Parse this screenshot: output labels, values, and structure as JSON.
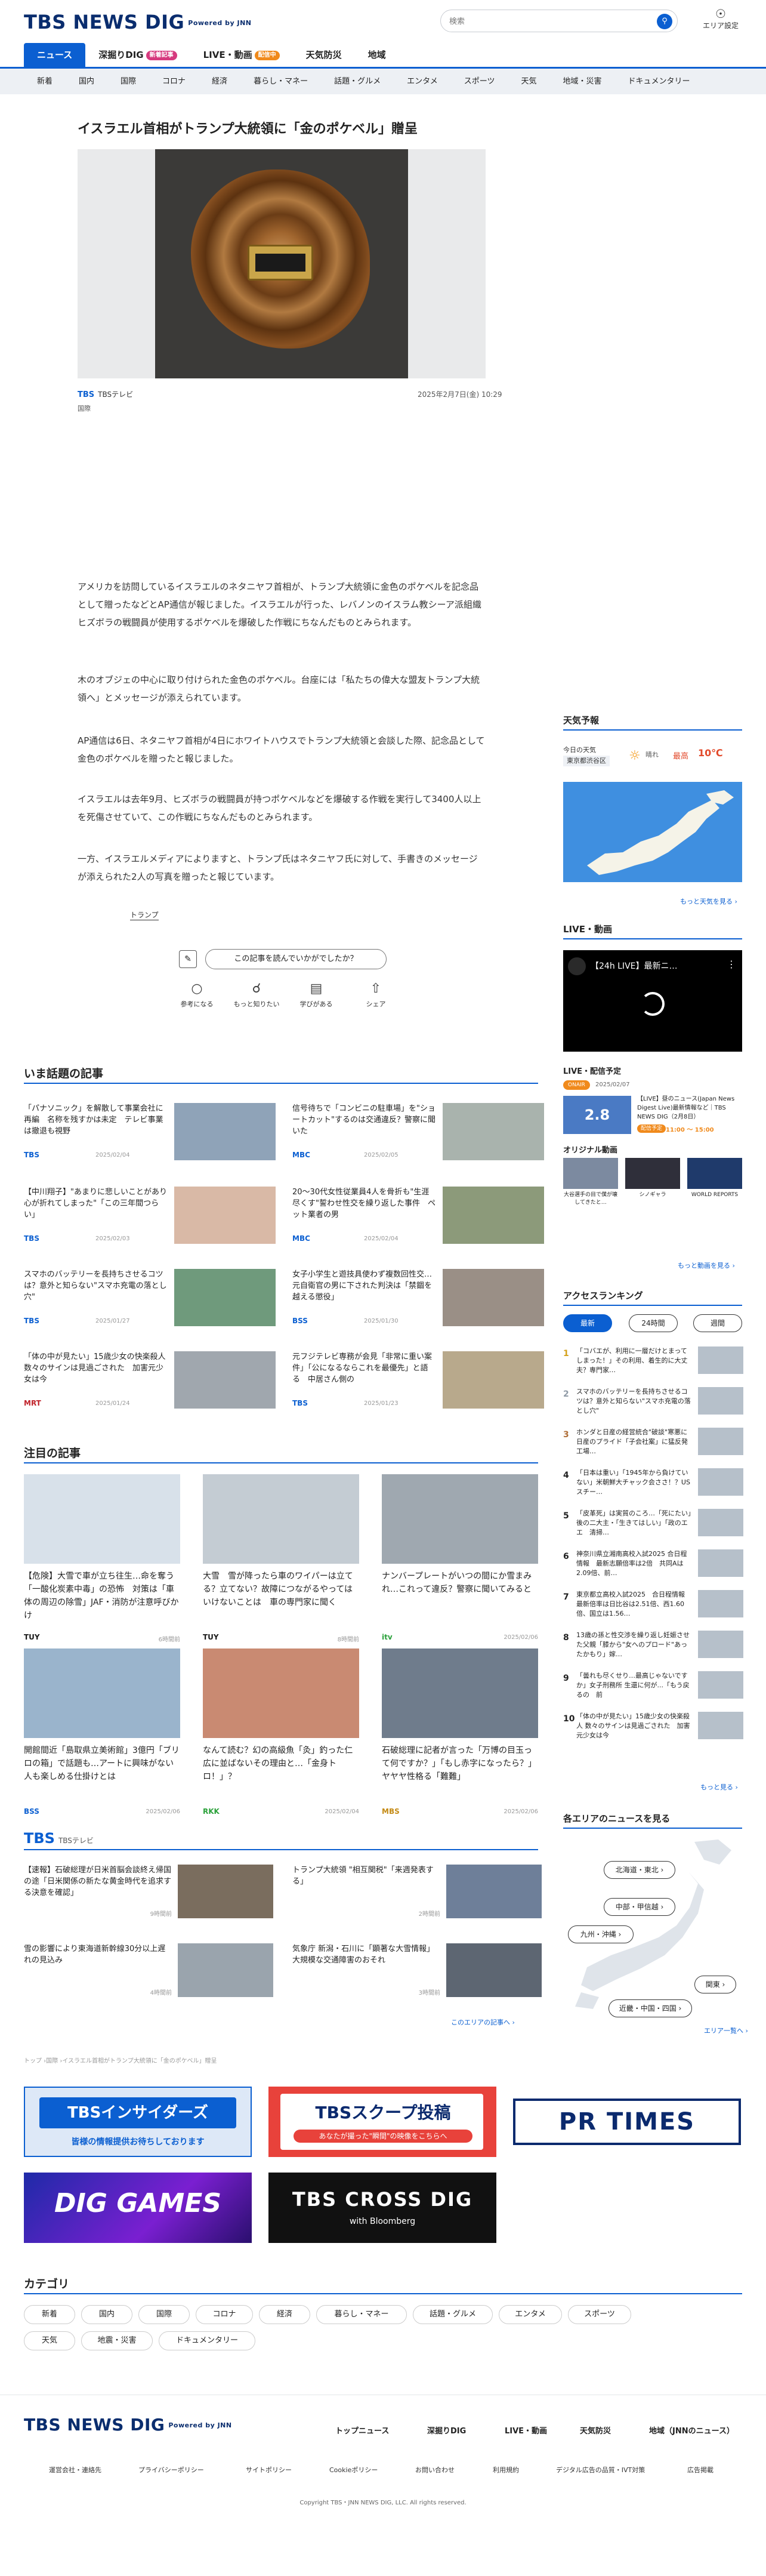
{
  "header": {
    "logo": "TBS NEWS DIG",
    "powered": "Powered by JNN",
    "search_placeholder": "検索",
    "area_label": "エリア設定",
    "tabs": [
      {
        "label": "ニュース",
        "badge": ""
      },
      {
        "label": "深掘りDIG",
        "badge": "新着記事"
      },
      {
        "label": "LIVE・動画",
        "badge": "配信中"
      },
      {
        "label": "天気防災",
        "badge": ""
      },
      {
        "label": "地域",
        "badge": ""
      }
    ],
    "categories": [
      "新着",
      "国内",
      "国際",
      "コロナ",
      "経済",
      "暮らし・マネー",
      "話題・グルメ",
      "エンタメ",
      "スポーツ",
      "天気",
      "地域・災害",
      "ドキュメンタリー"
    ]
  },
  "article": {
    "title": "イスラエル首相がトランプ大統領に「金のポケベル」贈呈",
    "source_logo": "TBS",
    "source": "TBSテレビ",
    "date": "2025年2月7日(金) 10:29",
    "category": "国際",
    "paragraphs": [
      "アメリカを訪問しているイスラエルのネタニヤフ首相が、トランプ大統領に金色のポケベルを記念品として贈ったなどとAP通信が報じました。イスラエルが行った、レバノンのイスラム教シーア派組織ヒズボラの戦闘員が使用するポケベルを爆破した作戦にちなんだものとみられます。",
      "木のオブジェの中心に取り付けられた金色のポケベル。台座には「私たちの偉大な盟友トランプ大統領へ」とメッセージが添えられています。",
      "AP通信は6日、ネタニヤフ首相が4日にホワイトハウスでトランプ大統領と会談した際、記念品として金色のポケベルを贈ったと報じました。",
      "イスラエルは去年9月、ヒズボラの戦闘員が持つポケベルなどを爆破する作戦を実行して3400人以上を死傷させていて、この作戦にちなんだものとみられます。",
      "一方、イスラエルメディアによりますと、トランプ氏はネタニヤフ氏に対して、手書きのメッセージが添えられた2人の写真を贈ったと報じています。"
    ],
    "tag": "トランプ",
    "survey_question": "この記事を読んでいかがでしたか？",
    "reactions": [
      "参考になる",
      "もっと知りたい",
      "学びがある",
      "シェア"
    ]
  },
  "popular": {
    "title": "いま話題の記事",
    "items": [
      {
        "text": "「パナソニック」を解散して事業会社に再編　名称を残すかは未定　テレビ事業は撤退も視野",
        "source": "TBS",
        "date": "2025/02/04"
      },
      {
        "text": "信号待ちで「コンビニの駐車場」を\"ショートカット\"するのは交通違反？警察に聞いた",
        "source": "MBC",
        "date": "2025/02/05"
      },
      {
        "text": "【中川翔子】\"あまりに悲しいことがあり心が折れてしまった\"「この三年間つらい」",
        "source": "TBS",
        "date": "2025/02/03"
      },
      {
        "text": "20〜30代女性従業員4人を骨折も\"生涯尽くす\"誓わせ性交を繰り返した事件　ペット業者の男",
        "source": "MBC",
        "date": "2025/02/04"
      },
      {
        "text": "スマホのバッテリーを長持ちさせるコツは？意外と知らない\"スマホ充電の落とし穴\"",
        "source": "TBS",
        "date": "2025/01/27"
      },
      {
        "text": "女子小学生と遊技具使わず複数回性交…元自衛官の男に下された判決は「禁錮を越える懲役」",
        "source": "BSS",
        "date": "2025/01/30"
      },
      {
        "text": "「体の中が見たい」15歳少女の快楽殺人　数々のサインは見過ごされた　加害元少女は今",
        "source": "MRT",
        "date": "2025/01/24"
      },
      {
        "text": "元フジテレビ専務が会見「非常に重い案件」「公になるならこれを最優先」と語る　中居さん側の",
        "source": "TBS",
        "date": "2025/01/23"
      }
    ]
  },
  "attention": {
    "title": "注目の記事",
    "items": [
      {
        "text": "【危険】大雪で車が立ち往生…命を奪う「一酸化炭素中毒」の恐怖　対策は「車体の周辺の除雪」JAF・消防が注意呼びかけ",
        "source": "TUY",
        "date": "6時間前"
      },
      {
        "text": "大雪　雪が降ったら車のワイパーは立てる？立てない？故障につながるやってはいけないことは　車の専門家に聞く",
        "source": "TUY",
        "date": "8時間前"
      },
      {
        "text": "ナンバープレートがいつの間にか雪まみれ…これって違反？警察に聞いてみると",
        "source": "itv",
        "date": "2025/02/06"
      },
      {
        "text": "開館間近「島取県立美術館」3億円「ブリロの箱」で話題も…アートに興味がない人も楽しめる仕掛けとは",
        "source": "BSS",
        "date": "2025/02/06"
      },
      {
        "text": "なんて読む？幻の高級魚「灸」釣った仁広に並ばないその理由と…「金身トロ！」？",
        "source": "RKK",
        "date": "2025/02/04"
      },
      {
        "text": "石破総理に記者が言った「万博の目玉って何ですか？」「もし赤字になったら？」ヤヤヤ性格る「難難」",
        "source": "MBS",
        "date": "2025/02/06"
      }
    ]
  },
  "region": {
    "logo": "TBS",
    "sub": "TBSテレビ",
    "items": [
      {
        "text": "【速報】石破総理が日米首脳会談終え帰国の途「日米関係の新たな黄金時代を追求する決意を確認」",
        "date": "9時間前"
      },
      {
        "text": "トランプ大統領 \"相互関税\"「来週発表する」",
        "date": "2時間前"
      },
      {
        "text": "雪の影響により東海道新幹線30分以上遅れの見込み",
        "date": "4時間前"
      },
      {
        "text": "気象庁 新潟・石川に「顕著な大雪情報」大規模な交通障害のおそれ",
        "date": "3時間前"
      }
    ],
    "more": "このエリアの記事へ ›"
  },
  "breadcrumb": "トップ ›国際 ›イスラエル首相がトランプ大統領に「金のポケベル」贈呈",
  "banners": [
    {
      "title": "TBSインサイダーズ",
      "sub": "皆様の情報提供お待ちしております"
    },
    {
      "title": "TBSスクープ投稿",
      "sub": "あなたが撮った\"瞬間\"の映像をこちらへ"
    },
    {
      "title": "PR TIMES",
      "sub": ""
    },
    {
      "title": "DIG GAMES",
      "sub": ""
    },
    {
      "title": "TBS CROSS DIG",
      "sub": "with Bloomberg"
    }
  ],
  "bottom_categories": {
    "title": "カテゴリ",
    "items": [
      "新着",
      "国内",
      "国際",
      "コロナ",
      "経済",
      "暮らし・マネー",
      "話題・グルメ",
      "エンタメ",
      "スポーツ",
      "天気",
      "地震・災害",
      "ドキュメンタリー"
    ]
  },
  "footer": {
    "nav": [
      "トップニュース",
      "深掘りDIG",
      "LIVE・動画",
      "天気防災",
      "地域（JNNのニュース）"
    ],
    "links": [
      "運営会社・連絡先",
      "プライバシーポリシー",
      "サイトポリシー",
      "Cookieポリシー",
      "お問い合わせ",
      "利用規約",
      "デジタル広告の品質・IVT対策",
      "広告掲載"
    ],
    "copyright": "Copyright TBS・JNN NEWS DIG, LLC. All rights reserved."
  },
  "sidebar": {
    "weather": {
      "title": "天気予報",
      "label": "今日の天気",
      "location": "東京都渋谷区",
      "condition": "晴れ",
      "label_high": "最高",
      "temp": "10℃",
      "more": "もっと天気を見る ›"
    },
    "live": {
      "title": "LIVE・動画",
      "video_title": "【24h LIVE】最新ニ…",
      "schedule_title": "LIVE・配信予定",
      "on_air": "ONAIR",
      "date": "2025/02/07",
      "program": "【LIVE】昼のニュース(Japan News Digest Live)最新情報など｜TBS NEWS DIG（2月8日）",
      "status": "配信予定",
      "time": "11:00 ～ 15:00",
      "thumb_value": "2.8",
      "original_title": "オリジナル動画",
      "originals": [
        "大谷選手の目で僕が壊してきたと…",
        "シノギャラ",
        "WORLD REPORTS"
      ],
      "more": "もっと動画を見る ›"
    },
    "ranking": {
      "title": "アクセスランキング",
      "tabs": [
        "最新",
        "24時間",
        "週間"
      ],
      "items": [
        "「コバエが、利用に一層だけとまってしまった！」その利用、着生的に大丈夫？専門家…",
        "スマホのバッテリーを長持ちさせるコツは？意外と知らない\"スマホ充電の落とし穴\"",
        "ホンダと日産の経営統合\"破談\"寒悪に日産のプライド「子会社案」に猛反発　工場…",
        "「日本は重い」「1945年から負けていない」米朝鮮大チャック会ささ！？USスチー…",
        "「皮革死」は実質のころ…「死にたい」後の二大主・「生きてはしい」「政のエエ　清掃…",
        "神奈川県立湘南高校入試2025 合日程情報　最新志願倍率は2倍　共同Aは2.09倍、前…",
        "東京都立高校入試2025　合日程情報　最新倍率は日比谷は2.51倍、西1.60倍、国立は1.56…",
        "13歳の孫と性交渉を繰り返し妊娠させた父親「膝から\"女へのプロード\"あったかもり」嫁…",
        "「曇れも尽くせり…最高じゃないですか」女子刑務所 生還に何が...「もう戻るの　前",
        "「体の中が見たい」15歳少女の快楽殺人 数々のサインは見過ごされた　加害元少女は今"
      ],
      "more": "もっと見る ›"
    },
    "areas": {
      "title": "各エリアのニュースを見る",
      "buttons": [
        "北海道・東北 ›",
        "中部・甲信越 ›",
        "九州・沖縄 ›",
        "関東 ›",
        "近畿・中国・四国 ›"
      ],
      "more": "エリア一覧へ ›"
    }
  }
}
